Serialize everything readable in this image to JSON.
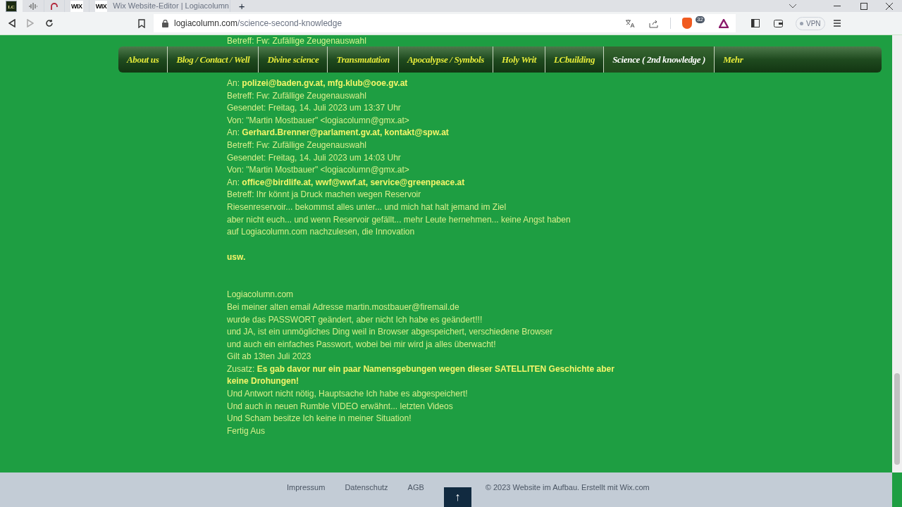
{
  "browser": {
    "tabs": [
      {
        "kind": "text-favicon",
        "favicon": "LC",
        "selected": true
      },
      {
        "kind": "wave-favicon",
        "selected": false
      },
      {
        "kind": "arc-favicon",
        "selected": false
      },
      {
        "kind": "text-favicon",
        "favicon": "WIX",
        "selected": false
      },
      {
        "kind": "titled",
        "favicon": "WIX",
        "title": "Wix Website-Editor | Logiacolumn",
        "selected": false
      }
    ],
    "new_tab": "+",
    "url_domain": "logiacolumn.com",
    "url_path": "/science-second-knowledge",
    "shield_count": "32",
    "vpn": "VPN"
  },
  "nav": {
    "items": [
      {
        "label": "About us",
        "selected": false
      },
      {
        "label": "Blog / Contact / Well",
        "selected": false
      },
      {
        "label": "Divine science",
        "selected": false
      },
      {
        "label": "Transmutation",
        "selected": false
      },
      {
        "label": "Apocalypse / Symbols",
        "selected": false
      },
      {
        "label": "Holy Writ",
        "selected": false
      },
      {
        "label": "LCbuilding",
        "selected": false
      },
      {
        "label": "Science ( 2nd knowledge )",
        "selected": true
      },
      {
        "label": "Mehr",
        "selected": false
      }
    ]
  },
  "content": {
    "top_line": "Betreff: Fw: Zufällige Zeugenauswahl",
    "blocks": [
      {
        "kind": "text",
        "lines": [
          "An: **polizei@baden.gv.at, mfg.klub@ooe.gv.at**",
          "Betreff: Fw: Zufällige Zeugenauswahl",
          "Gesendet: Freitag, 14. Juli 2023 um 13:37 Uhr",
          "Von: \"Martin Mostbauer\" <logiacolumn@gmx.at>",
          "An: **Gerhard.Brenner@parlament.gv.at, kontakt@spw.at**",
          "Betreff: Fw: Zufällige Zeugenauswahl",
          "Gesendet: Freitag, 14. Juli 2023 um 14:03 Uhr",
          "Von: \"Martin Mostbauer\" <logiacolumn@gmx.at>",
          "An: **office@birdlife.at, wwf@wwf.at, service@greenpeace.at**",
          "Betreff: Ihr könnt ja Druck machen wegen Reservoir",
          "Riesenreservoir... bekommst alles unter... und mich hat halt jemand im Ziel",
          "aber nicht euch... und wenn Reservoir gefällt... mehr Leute hernehmen... keine Angst haben",
          "auf Logiacolumn.com nachzulesen, die Innovation"
        ]
      },
      {
        "kind": "strong",
        "lines": [
          "usw."
        ]
      },
      {
        "kind": "text",
        "lines": [
          "Logiacolumn.com",
          "Bei meiner alten email Adresse martin.mostbauer@firemail.de",
          "wurde das PASSWORT geändert, aber nicht Ich habe es geändert!!!",
          "und JA, ist ein unmögliches Ding weil in Browser abgespeichert, verschiedene Browser",
          "und auch ein einfaches Passwort, wobei bei mir wird ja alles überwacht!",
          "Gilt ab 13ten Juli 2023",
          "Zusatz: **Es gab davor nur ein paar Namensgebungen wegen dieser SATELLITEN Geschichte aber keine Drohungen!**",
          "Und Antwort nicht nötig, Hauptsache Ich habe es abgespeichert!",
          "Und auch in neuen Rumble VIDEO erwähnt... letzten Videos",
          "Und Scham besitze Ich keine in meiner Situation!",
          "Fertig Aus"
        ]
      }
    ]
  },
  "footer": {
    "links": [
      "Impressum",
      "Datenschutz",
      "AGB"
    ],
    "copyright": "© 2023 Website im Aufbau. Erstellt mit ",
    "copyright_link": "Wix.com",
    "top_button": "↑"
  }
}
